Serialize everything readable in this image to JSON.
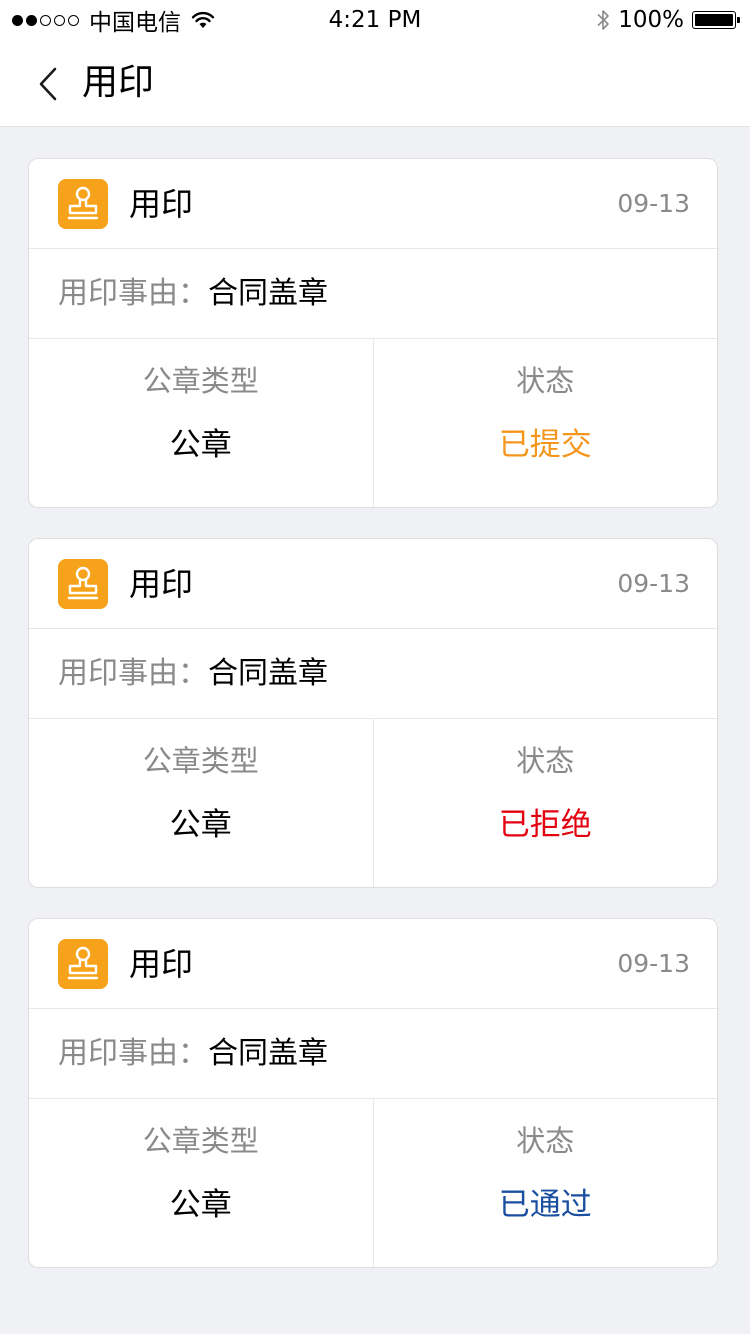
{
  "status_bar": {
    "carrier": "中国电信",
    "time": "4:21 PM",
    "battery": "100%",
    "signal_bars_filled": 2,
    "signal_bars_total": 5
  },
  "nav": {
    "title": "用印",
    "back_icon": "chevron-left-icon"
  },
  "cards": [
    {
      "app_name": "用印",
      "icon": "stamp-icon",
      "date": "09-13",
      "reason_label": "用印事由：",
      "reason_value": "合同盖章",
      "seal_type_label": "公章类型",
      "seal_type_value": "公章",
      "status_label": "状态",
      "status_value": "已提交",
      "status_color": "#f5961c"
    },
    {
      "app_name": "用印",
      "icon": "stamp-icon",
      "date": "09-13",
      "reason_label": "用印事由：",
      "reason_value": "合同盖章",
      "seal_type_label": "公章类型",
      "seal_type_value": "公章",
      "status_label": "状态",
      "status_value": "已拒绝",
      "status_color": "#e3000f"
    },
    {
      "app_name": "用印",
      "icon": "stamp-icon",
      "date": "09-13",
      "reason_label": "用印事由：",
      "reason_value": "合同盖章",
      "seal_type_label": "公章类型",
      "seal_type_value": "公章",
      "status_label": "状态",
      "status_value": "已通过",
      "status_color": "#1a4fa0"
    }
  ],
  "colors": {
    "icon_bg": "#f7a21b",
    "page_bg": "#f0f1f4"
  }
}
